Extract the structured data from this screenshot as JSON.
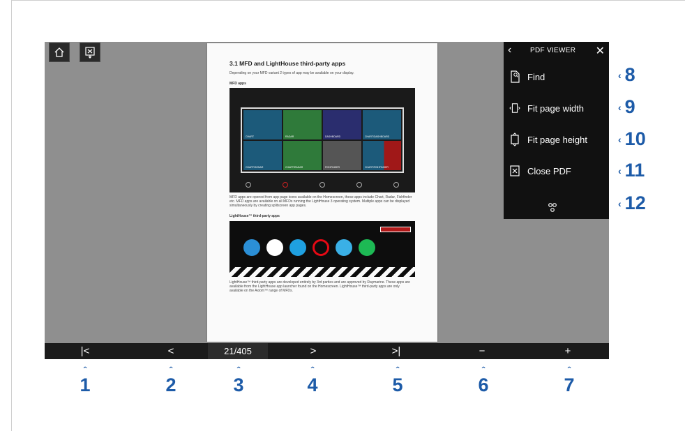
{
  "screen": {
    "toolbar": {
      "home_icon": "home-icon",
      "export_icon": "pdf-export-icon"
    },
    "pdf_page": {
      "title": "3.1 MFD and LightHouse third-party apps",
      "intro": "Depending on your MFD variant 2 types of app may be available on your display.",
      "mfd_heading": "MFD apps",
      "mfd_tiles": [
        "CHART",
        "RADAR",
        "DASHBOARD",
        "CHART/DASHBOARD",
        "CHART/SONAR",
        "CHART/RADAR",
        "FISHFINDER",
        "CHART/FISHFINDER"
      ],
      "mfd_bar_items": [
        "My data",
        "MOB",
        "Apps",
        "Alarms",
        "Settings"
      ],
      "mfd_text": "MFD apps are opened from app page icons available on the Homescreen, these apps include Chart, Radar, Fishfinder etc. MFD apps are available on all MFDs running the LightHouse 3 operating system. Multiple apps can be displayed simultaneously by creating splitscreen app pages.",
      "lh_heading": "LightHouse™ third-party apps",
      "lh_text": "LightHouse™ third-party apps are developed entirely by 3rd parties and are approved by Raymarine. These apps are available from the LightHouse app launcher found on the Homescreen. LightHouse™ third-party apps are only available on the Axiom™ range of MFDs."
    },
    "side_panel": {
      "title": "PDF VIEWER",
      "back_icon": "chevron-left-icon",
      "close_icon": "close-icon",
      "items": [
        {
          "label": "Find",
          "icon": "find-icon"
        },
        {
          "label": "Fit page width",
          "icon": "fit-width-icon"
        },
        {
          "label": "Fit page height",
          "icon": "fit-height-icon"
        },
        {
          "label": "Close PDF",
          "icon": "close-pdf-icon"
        }
      ],
      "share_icon": "share-icon"
    },
    "bottom_bar": {
      "first": "|<",
      "prev": "<",
      "page_indicator": "21/405",
      "next": ">",
      "last": ">|",
      "zoom_out": "−",
      "zoom_in": "+"
    }
  },
  "callouts": {
    "bottom": [
      "1",
      "2",
      "3",
      "4",
      "5",
      "6",
      "7"
    ],
    "right": [
      "8",
      "9",
      "10",
      "11",
      "12"
    ]
  },
  "colors": {
    "callout": "#1d5ba8",
    "panel": "#111111",
    "screen_bg": "#8f8f8f"
  }
}
